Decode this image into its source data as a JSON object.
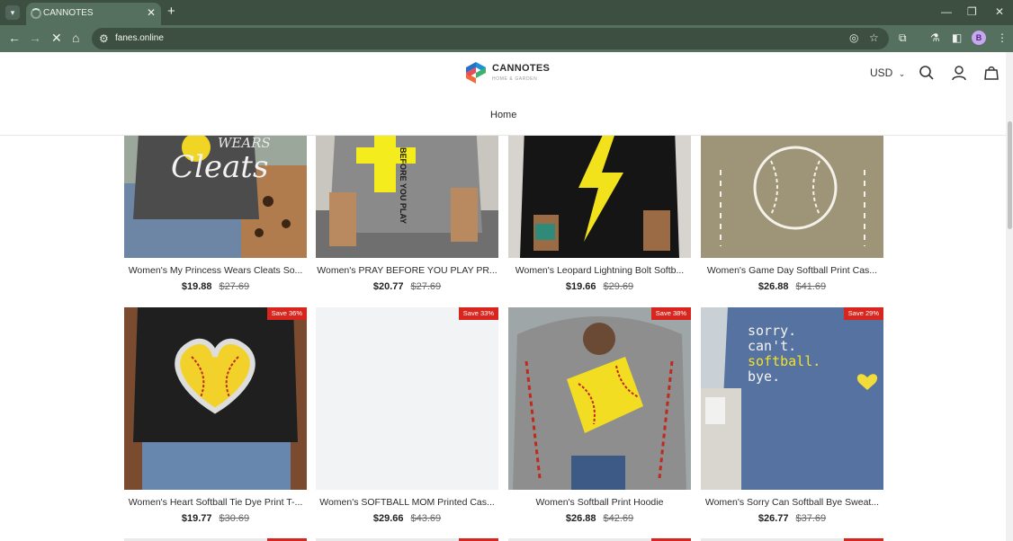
{
  "browser": {
    "tab_title": "CANNOTES",
    "url": "fanes.online",
    "profile_initial": "B"
  },
  "store": {
    "brand": "CANNOTES",
    "tagline": "HOME & GARDEN",
    "currency": "USD",
    "nav_home": "Home"
  },
  "products": [
    {
      "title": "Women's My Princess Wears Cleats So...",
      "price": "$19.88",
      "compare": "$27.69",
      "badge": ""
    },
    {
      "title": "Women's PRAY BEFORE YOU PLAY PR...",
      "price": "$20.77",
      "compare": "$27.69",
      "badge": ""
    },
    {
      "title": "Women's Leopard Lightning Bolt Softb...",
      "price": "$19.66",
      "compare": "$29.69",
      "badge": ""
    },
    {
      "title": "Women's Game Day Softball Print Cas...",
      "price": "$26.88",
      "compare": "$41.69",
      "badge": ""
    },
    {
      "title": "Women's Heart Softball Tie Dye Print T-...",
      "price": "$19.77",
      "compare": "$30.69",
      "badge": "Save 36%"
    },
    {
      "title": "Women's SOFTBALL MOM Printed Cas...",
      "price": "$29.66",
      "compare": "$43.69",
      "badge": "Save 33%"
    },
    {
      "title": "Women's Softball Print Hoodie",
      "price": "$26.88",
      "compare": "$42.69",
      "badge": "Save 38%"
    },
    {
      "title": "Women's Sorry Can Softball Bye Sweat...",
      "price": "$26.77",
      "compare": "$37.69",
      "badge": "Save 29%"
    }
  ],
  "image_text": {
    "cleats_word": "Cleats",
    "wears_word": "WEARS",
    "pray_text": "BEFORE YOU PLAY",
    "sorry_l1": "sorry.",
    "sorry_l2": "can't.",
    "sorry_l3": "softball.",
    "sorry_l4": "bye."
  },
  "icons": [
    "chevron-down-icon",
    "close-icon",
    "plus-icon",
    "back-icon",
    "forward-icon",
    "stop-icon",
    "home-icon",
    "site-info-icon",
    "eye-off-icon",
    "star-icon",
    "extensions-icon",
    "labs-icon",
    "side-panel-icon",
    "menu-icon",
    "search-icon",
    "account-icon",
    "cart-icon"
  ],
  "colors": {
    "badge": "#d8261e",
    "chrome": "#56705f",
    "chrome_dark": "#3c4f41"
  }
}
